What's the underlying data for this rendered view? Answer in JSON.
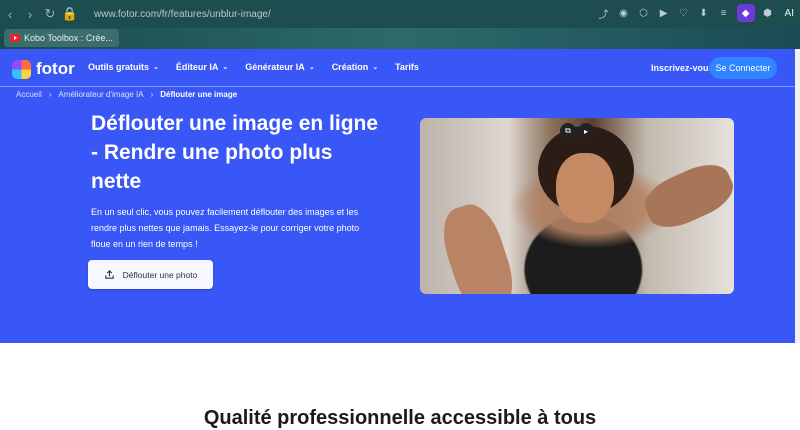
{
  "browser": {
    "url": "www.fotor.com/fr/features/unblur-image/",
    "bookmark": "Kobo Toolbox : Crée...",
    "ai_label": "AI"
  },
  "site": {
    "logo": "fotor",
    "menu": [
      "Outils gratuits",
      "Éditeur IA",
      "Générateur IA",
      "Création",
      "Tarifs"
    ],
    "signup": "Inscrivez-vous",
    "login": "Se Connecter"
  },
  "breadcrumb": [
    "Accueil",
    "Améliorateur d'image IA",
    "Déflouter une image"
  ],
  "hero": {
    "title": "Déflouter une image en ligne - Rendre une photo plus nette",
    "description": "En un seul clic, vous pouvez facilement déflouter des images et les rendre plus nettes que jamais. Essayez-le pour corriger votre photo floue en un rien de temps !",
    "cta": "Déflouter une photo"
  },
  "section_title": "Qualité professionnelle accessible à tous"
}
